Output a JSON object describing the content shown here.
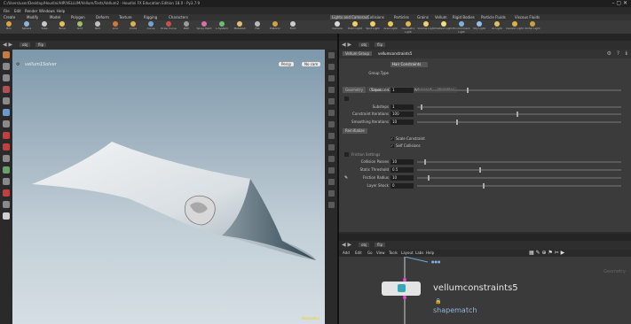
{
  "window": {
    "title": "C:/Users/user/Desktop/Houdini/HIP/VELLUM/Vellum/Tests/Vellum2 - Houdini FX Education Edition 18.0 - Py3.7.9"
  },
  "menu": [
    "File",
    "Edit",
    "Render",
    "Windows",
    "Help"
  ],
  "shelf": {
    "tabs": [
      "Create",
      "Modify",
      "Model",
      "Polygon",
      "Deform",
      "Texture",
      "Rigging",
      "Characters"
    ],
    "tools": [
      "Box",
      "Sphere",
      "Tube",
      "Torus",
      "Grid",
      "Null",
      "Line",
      "Circle",
      "Curve",
      "Draw Curve",
      "Path",
      "Spray Paint",
      "L-System",
      "Metaball",
      "File",
      "Platonic",
      "Font"
    ],
    "right_tabs": [
      "Lights and Cameras",
      "Collisions",
      "Particles",
      "Grains",
      "Vellum",
      "Rigid Bodies",
      "Particle Fluids",
      "Viscous Fluids"
    ],
    "right_tools": [
      "Camera",
      "Point Light",
      "Spot Light",
      "Area Light",
      "Geometry Light",
      "Volume Light",
      "Distant Light",
      "Environment Light",
      "Sky Light",
      "GI Light",
      "Caustic Light",
      "Portal Light"
    ]
  },
  "viewport": {
    "tabs": [
      "Scene View",
      "Render View",
      "Composite View",
      "Motion FX View"
    ],
    "path": "obj",
    "node": "flip",
    "label": "vellum1Solver",
    "persp": "Persp",
    "camera": "No cam",
    "footer": "Geometry"
  },
  "params": {
    "tabs": [
      "Parameters",
      "Take List",
      "Performance Monitor"
    ],
    "path": "obj",
    "node": "flip",
    "header_type": "Vellum Group",
    "header_name": "vellumconstraints5",
    "group_type_label": "Group Type",
    "group_type_value": "Hair Constraints",
    "subtabs": [
      "Geometry",
      "Output",
      "Constraints",
      "Advanced",
      "Variables"
    ],
    "rows": [
      {
        "label": "Timescale",
        "value": "1"
      },
      {
        "label": "Substeps",
        "value": "1"
      },
      {
        "label": "Constraint Iterations",
        "value": "100"
      },
      {
        "label": "Smoothing Iterations",
        "value": "10"
      }
    ],
    "button": "Reinitialize",
    "check1": "Scale Constraint",
    "check2": "Self Collisions",
    "section2": "Friction Settings",
    "rows2": [
      {
        "label": "Collision Passes",
        "value": "10"
      },
      {
        "label": "Static Threshold",
        "value": "0.5"
      },
      {
        "label": "Friction Radius",
        "value": "10"
      },
      {
        "label": "Layer Shock",
        "value": "0"
      }
    ]
  },
  "network": {
    "tabs": [
      "Network",
      "Tree View",
      "Material Palette",
      "Asset Browser"
    ],
    "path": "obj",
    "node": "flip",
    "menu": [
      "Add",
      "Edit",
      "Go",
      "View",
      "Tools",
      "Layout",
      "Labs",
      "Help"
    ],
    "context": "Geometry",
    "node_name": "vellumconstraints5",
    "node_comment": "shapematch"
  }
}
